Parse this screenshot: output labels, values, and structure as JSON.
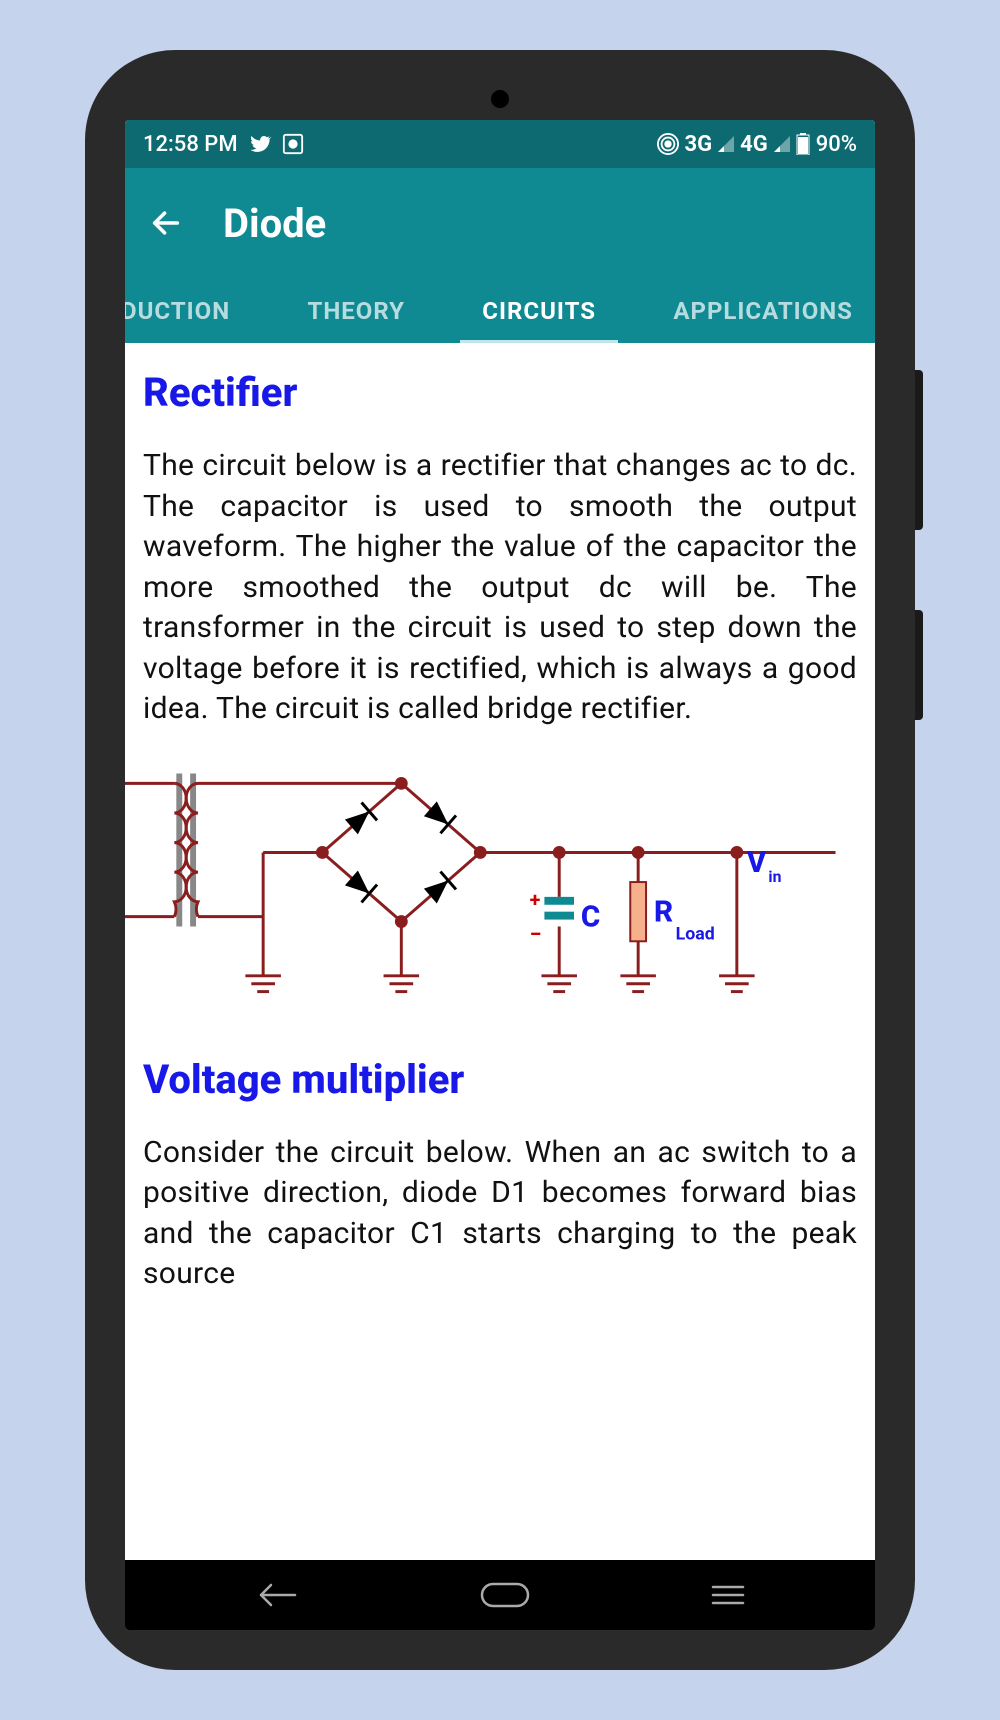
{
  "status": {
    "time": "12:58 PM",
    "network1": "3G",
    "network2": "4G",
    "battery": "90%"
  },
  "appbar": {
    "title": "Diode"
  },
  "tabs": {
    "t0": "DUCTION",
    "t1": "THEORY",
    "t2": "CIRCUITS",
    "t3": "APPLICATIONS"
  },
  "content": {
    "section1_title": "Rectifier",
    "section1_body": "The circuit below is a rectifier that changes ac to dc. The capacitor is used to smooth the output waveform. The higher the value of the capacitor the more smoothed the output dc will be. The transformer in the circuit is used to step down the voltage before it is rectified, which is always a good idea. The circuit is called bridge rectifier.",
    "section2_title": "Voltage multiplier",
    "section2_body": "Consider the circuit below. When an ac switch to a positive direction, diode D1 becomes forward bias and the capacitor C1 starts charging to the peak source",
    "diagram": {
      "labels": {
        "c": "C",
        "r": "R",
        "load": "Load",
        "v": "V",
        "in": "in",
        "plus": "+",
        "minus": "−"
      }
    }
  }
}
